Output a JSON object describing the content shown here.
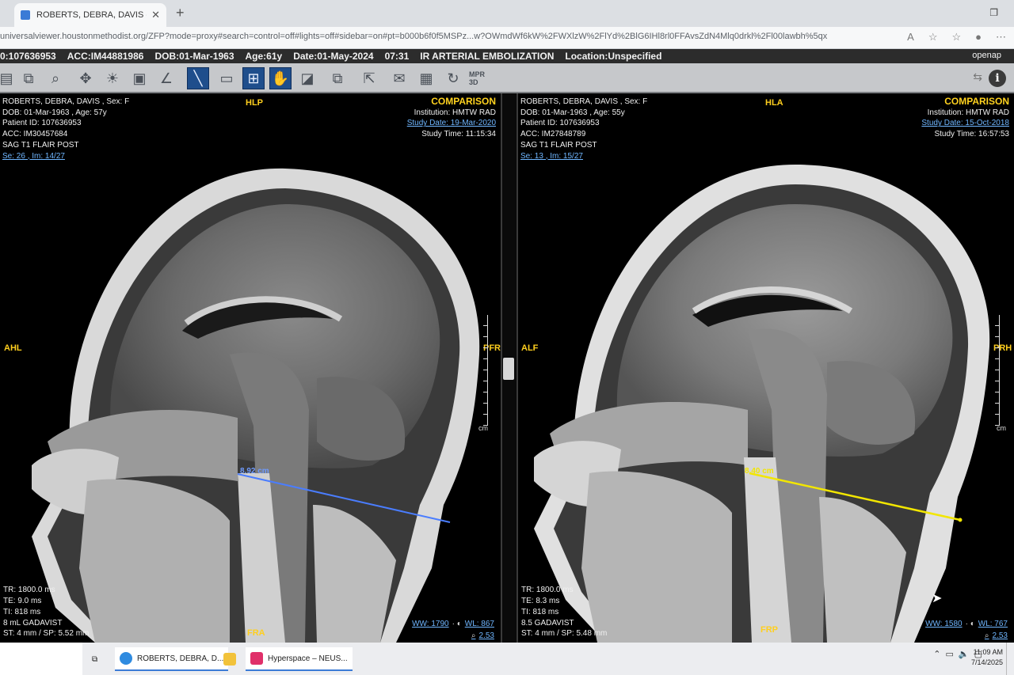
{
  "browser": {
    "tab_title": "ROBERTS, DEBRA, DAVIS - Unive",
    "url": "universalviewer.houstonmethodist.org/ZFP?mode=proxy#search=control=off#lights=off#sidebar=on#pt=b000b6f0f5MSPz...w?OWmdWf6kW%2FWXlzW%2FlYd%2BlG6IHl8rl0FFAvsZdN4Mlq0drkl%2Fl00lawbh%5qx"
  },
  "banner": {
    "id": "0:107636953",
    "acc": "ACC:IM44881986",
    "dob": "DOB:01-Mar-1963",
    "age": "Age:61y",
    "date": "Date:01-May-2024",
    "time": "07:31",
    "study": "IR ARTERIAL EMBOLIZATION",
    "location": "Location:Unspecified",
    "brand": "openap"
  },
  "toolbar": {
    "info_label": "i",
    "tools": [
      "layout-tool",
      "stack-tool",
      "zoom-tool",
      "pan-tool",
      "window-level-tool",
      "cine-tool",
      "measure-angle-tool",
      "line-measure-tool",
      "ruler-tool",
      "grid-layout-tool",
      "hand-tool",
      "invert-tool",
      "copy-tool",
      "export-tool",
      "email-tool",
      "calendar-tool",
      "reset-tool",
      "mpr-3d-tool"
    ],
    "mpr_label": "MPR 3D"
  },
  "left": {
    "name": "ROBERTS, DEBRA, DAVIS  ,  Sex: F",
    "dob": "DOB: 01-Mar-1963  ,  Age: 57y",
    "pid": "Patient ID: 107636953",
    "acc": "ACC: IM30457684",
    "series": "SAG T1 FLAIR POST",
    "se": "Se: 26  ,  Im: 14/27",
    "comparison": "COMPARISON",
    "institution": "Institution: HMTW RAD",
    "study_date": "Study Date: 19-Mar-2020",
    "study_time": "Study Time: 11:15:34",
    "top": "HLP",
    "left_orient": "AHL",
    "right_orient": "PFR",
    "bottom": "FRA",
    "tr": "TR: 1800.0 ms",
    "te": "TE: 9.0 ms",
    "ti": "TI: 818 ms",
    "contrast": "8 mL GADAVIST",
    "st": "ST: 4 mm  /  SP: 5.52 mm",
    "ww": "WW: 1790",
    "wl": "WL: 867",
    "zoom": "2.53",
    "measure": "8.92 cm",
    "ruler_unit": "cm"
  },
  "right": {
    "name": "ROBERTS, DEBRA, DAVIS  ,  Sex: F",
    "dob": "DOB: 01-Mar-1963  ,  Age: 55y",
    "pid": "Patient ID: 107636953",
    "acc": "ACC: IM27848789",
    "series": "SAG T1 FLAIR POST",
    "se": "Se: 13  ,  Im: 15/27",
    "comparison": "COMPARISON",
    "institution": "Institution: HMTW RAD",
    "study_date": "Study Date: 15-Oct-2018",
    "study_time": "Study Time: 16:57:53",
    "top": "HLA",
    "left_orient": "ALF",
    "right_orient": "PRH",
    "bottom": "FRP",
    "tr": "TR: 1800.0 ms",
    "te": "TE: 8.3 ms",
    "ti": "TI: 818 ms",
    "contrast": "8.5 GADAVIST",
    "st": "ST: 4 mm  /  SP: 5.48 mm",
    "ww": "WW: 1580",
    "wl": "WL: 767",
    "zoom": "2.53",
    "measure": "8.40 cm",
    "ruler_unit": "cm"
  },
  "taskbar": {
    "item1": "ROBERTS, DEBRA, D...",
    "item3": "Hyperspace – NEUS...",
    "time": "11:09 AM",
    "date": "7/14/2025"
  },
  "colors": {
    "measure_left": "#4a7dff",
    "measure_right": "#f2e600",
    "orient": "#ffcf1e"
  }
}
